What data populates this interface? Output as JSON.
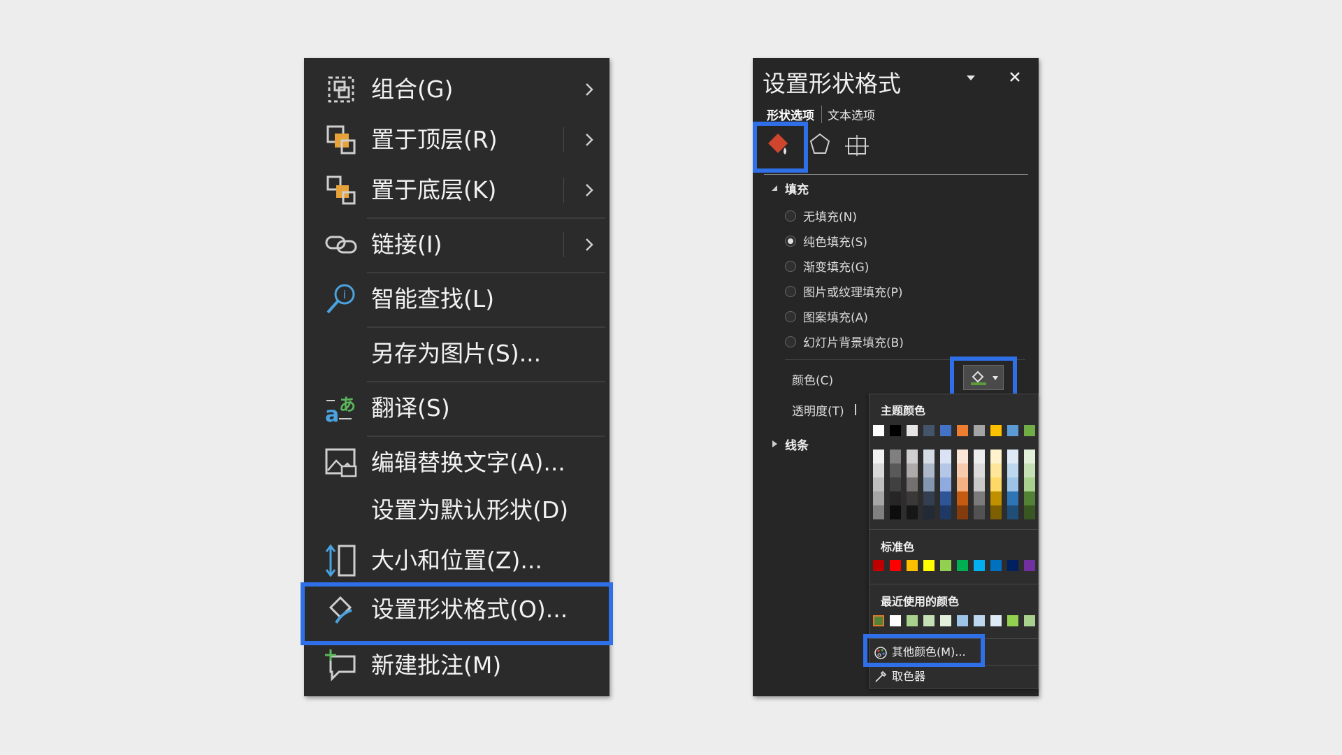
{
  "context_menu": {
    "items": [
      {
        "label": "组合(G)",
        "icon": "group-icon",
        "submenu": true
      },
      {
        "label": "置于顶层(R)",
        "icon": "bring-to-front-icon",
        "submenu": true
      },
      {
        "label": "置于底层(K)",
        "icon": "send-to-back-icon",
        "submenu": true
      },
      {
        "label": "链接(I)",
        "icon": "link-icon",
        "submenu": true
      },
      {
        "label": "智能查找(L)",
        "icon": "smart-lookup-icon",
        "submenu": false
      },
      {
        "label": "另存为图片(S)...",
        "icon": "",
        "submenu": false
      },
      {
        "label": "翻译(S)",
        "icon": "translate-icon",
        "submenu": false
      },
      {
        "label": "编辑替换文字(A)...",
        "icon": "alt-text-icon",
        "submenu": false
      },
      {
        "label": "设置为默认形状(D)",
        "icon": "",
        "submenu": false
      },
      {
        "label": "大小和位置(Z)...",
        "icon": "size-position-icon",
        "submenu": false
      },
      {
        "label": "设置形状格式(O)...",
        "icon": "format-shape-icon",
        "submenu": false,
        "highlighted": true
      },
      {
        "label": "新建批注(M)",
        "icon": "new-comment-icon",
        "submenu": false
      }
    ]
  },
  "format_pane": {
    "title": "设置形状格式",
    "tabs": [
      "形状选项",
      "文本选项"
    ],
    "active_tab": "形状选项",
    "fill_section": "填充",
    "fill_options": [
      "无填充(N)",
      "纯色填充(S)",
      "渐变填充(G)",
      "图片或纹理填充(P)",
      "图案填充(A)",
      "幻灯片背景填充(B)"
    ],
    "selected_fill": "纯色填充(S)",
    "color_label": "颜色(C)",
    "transparency_label": "透明度(T)",
    "line_section": "线条"
  },
  "palette": {
    "theme_label": "主题颜色",
    "theme_colors": [
      "#ffffff",
      "#000000",
      "#e7e6e6",
      "#44546a",
      "#4472c4",
      "#ed7d31",
      "#a5a5a5",
      "#ffc000",
      "#5b9bd5",
      "#70ad47"
    ],
    "tint_columns": [
      [
        "#f2f2f2",
        "#d9d9d9",
        "#bfbfbf",
        "#a6a6a6",
        "#808080"
      ],
      [
        "#808080",
        "#595959",
        "#404040",
        "#262626",
        "#0d0d0d"
      ],
      [
        "#d0cece",
        "#aeaaaa",
        "#757070",
        "#3b3838",
        "#171616"
      ],
      [
        "#d6dce4",
        "#adb9ca",
        "#8497b0",
        "#333f4f",
        "#222a35"
      ],
      [
        "#dae3f3",
        "#b4c7e7",
        "#8faadc",
        "#2f5597",
        "#1f3864"
      ],
      [
        "#fbe5d6",
        "#f8cbad",
        "#f4b183",
        "#c55a11",
        "#843c0c"
      ],
      [
        "#ededed",
        "#dbdbdb",
        "#c9c9c9",
        "#7b7b7b",
        "#525252"
      ],
      [
        "#fff2cc",
        "#ffe699",
        "#ffd966",
        "#bf9000",
        "#7f6000"
      ],
      [
        "#deebf7",
        "#bdd7ee",
        "#9dc3e6",
        "#2e75b6",
        "#1f4e79"
      ],
      [
        "#e2f0d9",
        "#c5e0b4",
        "#a9d18e",
        "#548235",
        "#385723"
      ]
    ],
    "standard_label": "标准色",
    "standard_colors": [
      "#c00000",
      "#ff0000",
      "#ffc000",
      "#ffff00",
      "#92d050",
      "#00b050",
      "#00b0f0",
      "#0070c0",
      "#002060",
      "#7030a0"
    ],
    "recent_label": "最近使用的颜色",
    "recent_colors": [
      "#548235",
      "#ffffff",
      "#a9d18e",
      "#c5e0b4",
      "#e2f0d9",
      "#9dc3e6",
      "#bdd7ee",
      "#deebf7",
      "#92d050",
      "#a9d18e"
    ],
    "more_colors": "其他颜色(M)...",
    "eyedropper": "取色器"
  }
}
